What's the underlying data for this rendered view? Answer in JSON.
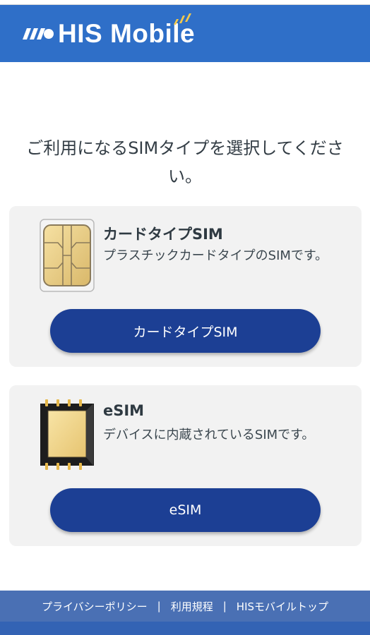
{
  "header": {
    "logo_text": "HIS Mobile",
    "brand_color": "#2f6fc8",
    "accent_color": "#f5c94a"
  },
  "prompt": "ご利用になるSIMタイプを選択してください。",
  "cards": [
    {
      "icon": "physical-sim-chip-icon",
      "title": "カードタイプSIM",
      "description": "プラスチックカードタイプのSIMです。",
      "button_label": "カードタイプSIM"
    },
    {
      "icon": "esim-chip-icon",
      "title": "eSIM",
      "description": "デバイスに内蔵されているSIMです。",
      "button_label": "eSIM"
    }
  ],
  "footer": {
    "links": [
      "プライバシーポリシー",
      "利用規程",
      "HISモバイルトップ"
    ],
    "separator": "|"
  },
  "colors": {
    "button": "#1c3f94",
    "card_bg": "#f2f2f2",
    "footer": "#4a70b4"
  }
}
